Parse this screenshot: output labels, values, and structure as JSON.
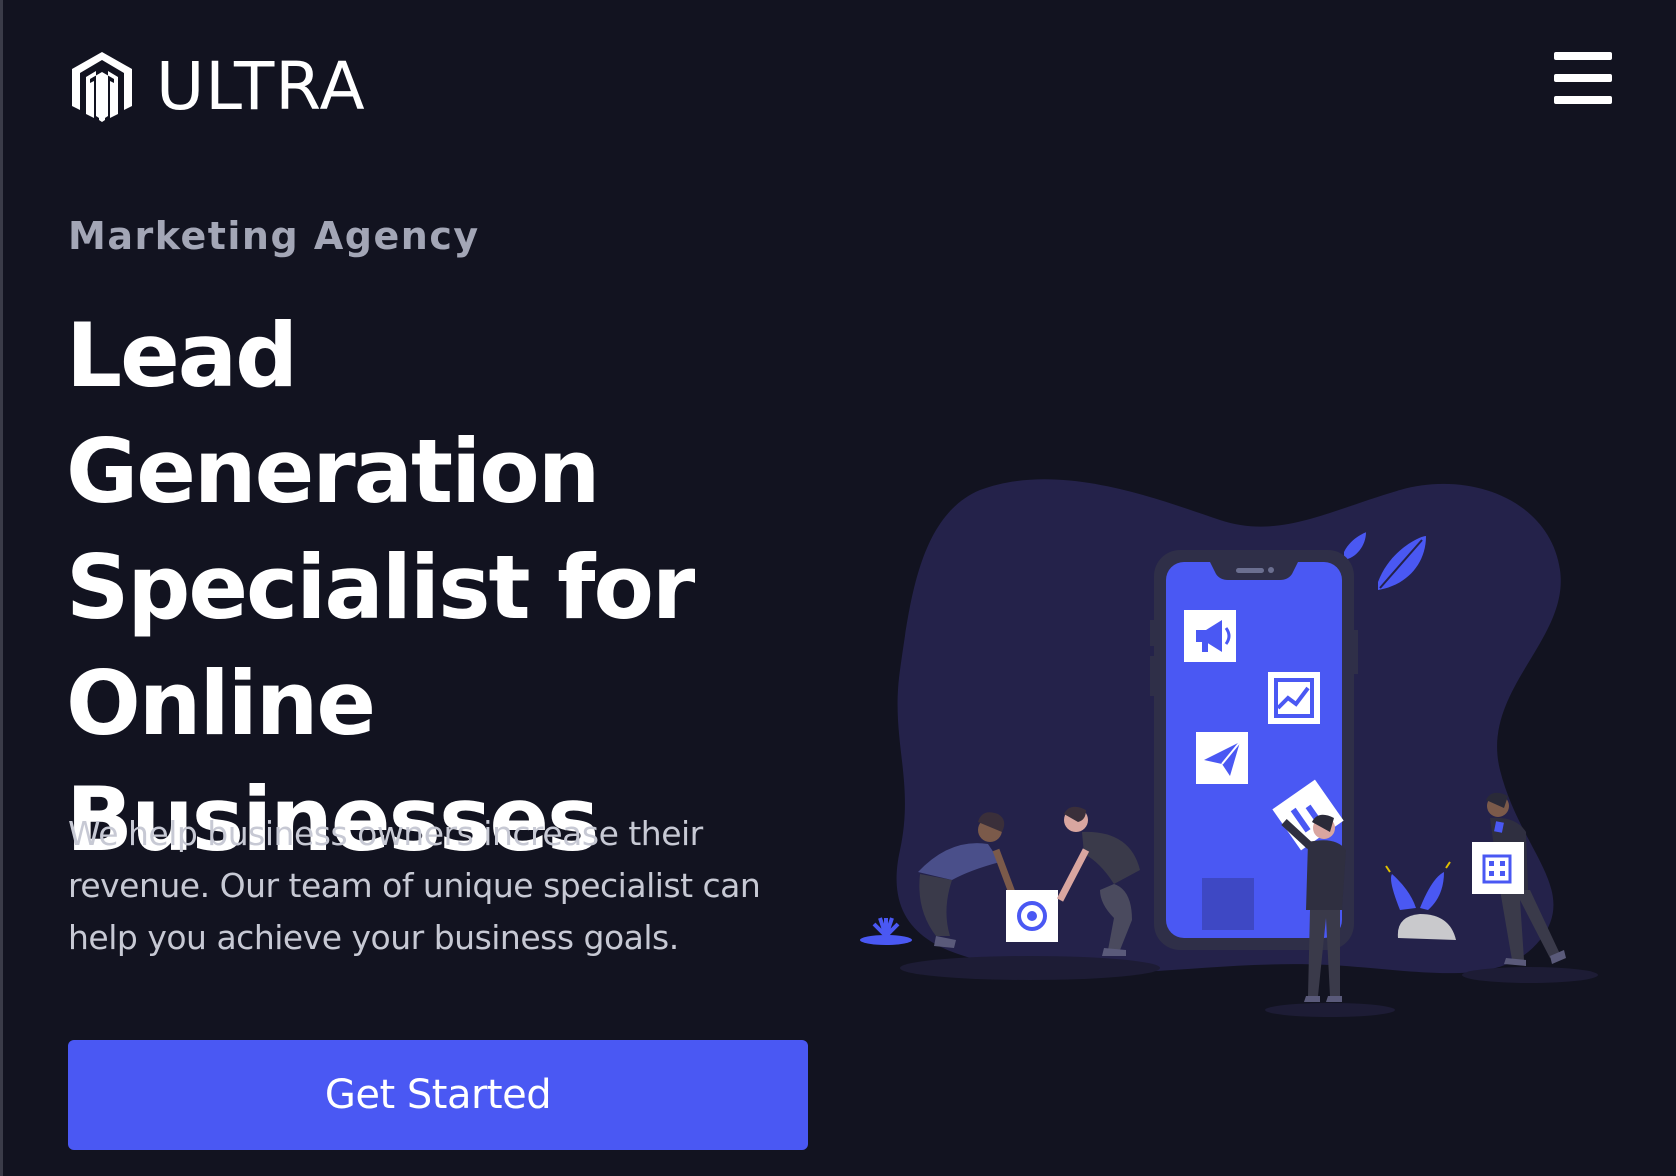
{
  "brand": {
    "name": "ULTRA"
  },
  "hero": {
    "eyebrow": "Marketing Agency",
    "headline_lines": [
      "Lead Generation",
      "Specialist for",
      "Online",
      "Businesses"
    ],
    "lede_lines": [
      "We help business owners increase their",
      "revenue. Our team of unique specialist can",
      "help you achieve your business goals."
    ],
    "cta_label": "Get Started"
  },
  "icons": {
    "logo": "brand-logo-icon",
    "menu": "hamburger-menu-icon",
    "tiles": [
      "megaphone-icon",
      "chart-icon",
      "paper-plane-icon",
      "at-sign-icon",
      "building-icon"
    ]
  },
  "colors": {
    "background": "#121320",
    "accent": "#4a58f3",
    "text_primary": "#ffffff",
    "text_muted": "#a3a6b6",
    "blob": "#24224a"
  }
}
